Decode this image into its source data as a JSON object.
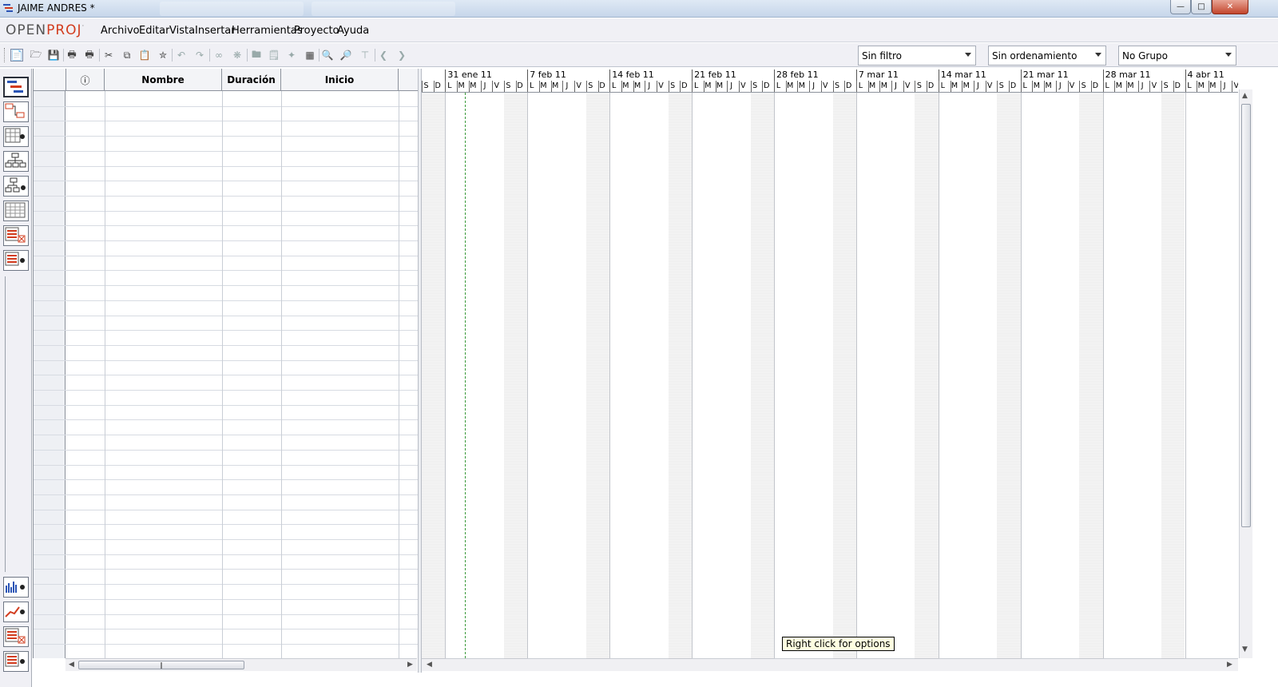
{
  "window": {
    "title": "JAIME ANDRES *"
  },
  "menubar": {
    "logo_open": "OPEN",
    "logo_proj": "PROJ",
    "logo_tm": "·",
    "items": [
      "Archivo",
      "Editar",
      "Vista",
      "Insertar",
      "Herramientas",
      "Proyecto",
      "Ayuda"
    ]
  },
  "toolbar": {
    "icons": [
      "new-project-icon",
      "open-icon",
      "save-icon",
      "print-icon",
      "print-preview-icon",
      "cut-icon",
      "copy-icon",
      "paste-icon",
      "find-icon",
      "undo-icon",
      "redo-icon",
      "link-icon",
      "unlink-icon",
      "task-info-icon",
      "notes-icon",
      "resource-assign-icon",
      "calendar-icon",
      "zoom-in-icon",
      "zoom-out-icon",
      "scroll-to-task-icon",
      "indent-left-icon",
      "indent-right-icon"
    ],
    "filter": "Sin filtro",
    "sort": "Sin ordenamiento",
    "group": "No Grupo"
  },
  "sidebar": {
    "views": [
      "gantt-view",
      "network-view",
      "resources-view",
      "wbs-view",
      "rbs-view",
      "project-view",
      "task-usage-view",
      "resource-usage-view"
    ],
    "bottom_views": [
      "histogram-view",
      "charts-view",
      "task-usage-view-2",
      "resource-usage-view-2"
    ]
  },
  "table": {
    "columns": {
      "info": "ⓘ",
      "name": "Nombre",
      "duration": "Duración",
      "start": "Inicio"
    }
  },
  "gantt": {
    "weeks": [
      "31 ene 11",
      "7 feb 11",
      "14 feb 11",
      "21 feb 11",
      "28 feb 11",
      "7 mar 11",
      "14 mar 11",
      "21 mar 11",
      "28 mar 11",
      "4 abr 11"
    ],
    "day_letters": [
      "L",
      "M",
      "M",
      "J",
      "V",
      "S",
      "D"
    ],
    "lead_days": [
      "S",
      "D"
    ],
    "tooltip": "Right click for options"
  },
  "colors": {
    "accent": "#d23c1e",
    "today_line": "#3a9a3a"
  }
}
